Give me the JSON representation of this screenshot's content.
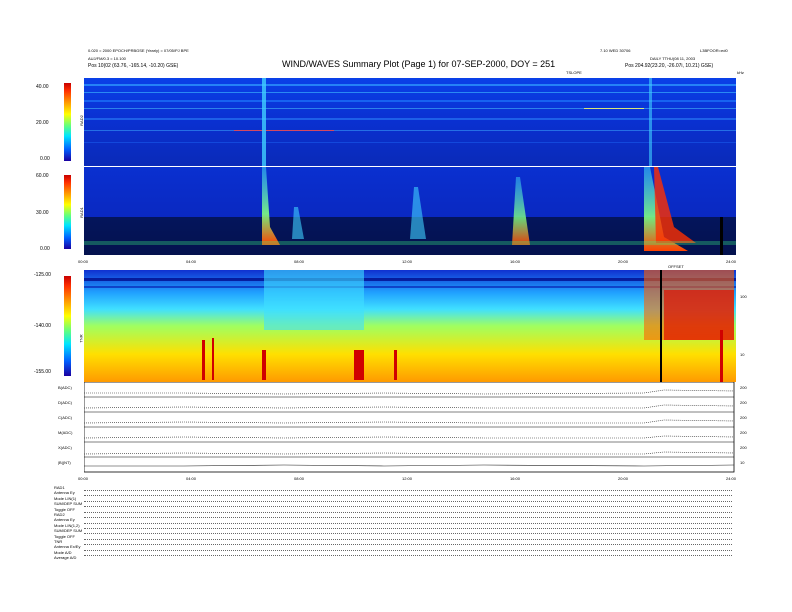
{
  "header": {
    "title": "WIND/WAVES Summary Plot (Page 1) for 07-SEP-2000, DOY = 251",
    "left_line1": "0.020 = 2000 EPOCH/PRBGSE (Yearly) = 07/05/PJ BPE",
    "left_line2": "AUJ/FM/0.3 = 10.100",
    "left_line3": "Pos     10(02 (63.76, -165.14, -10.20) GSE)",
    "right_line1": "7.10 WED 30706",
    "right_line1b": "L3BFOOR=ed0",
    "right_line2": "DAILY TTHU(08 11, 2003",
    "right_line3": "Pos     204.92(23.20, -26.07i, 10.21) GSE)",
    "tag_top": "TSLOPE",
    "tag_rt": "kHz"
  },
  "rad2": {
    "label": "RAD2",
    "ticks": [
      "40.00",
      "20.00",
      "0.00"
    ]
  },
  "rad1": {
    "label": "RAD1",
    "ticks": [
      "60.00",
      "30.00",
      "0.00"
    ]
  },
  "tnr": {
    "label": "TNR",
    "ticks": [
      "-125.00",
      "-140.00",
      "-155.00"
    ],
    "right_ticks": [
      "100",
      "10"
    ],
    "tag": "OFFSET"
  },
  "time_axis": {
    "ticks": [
      "00:00",
      "04:00",
      "08:00",
      "12:00",
      "16:00",
      "20:00",
      "24:00"
    ]
  },
  "line_panels": [
    {
      "label": "B(ADC)",
      "right": "200"
    },
    {
      "label": "D(ADC)",
      "right": "200"
    },
    {
      "label": "C(ADC)",
      "right": "200"
    },
    {
      "label": "M(ADC)",
      "right": "200"
    },
    {
      "label": "X(ADC)",
      "right": "200"
    },
    {
      "label": "|B|(NT)",
      "right": "10"
    }
  ],
  "settings": [
    {
      "label": "RAD1",
      "value": ""
    },
    {
      "label": "Antenna",
      "value": "Ey"
    },
    {
      "label": "Mode",
      "value": "LIN(1)"
    },
    {
      "label": "SUM/DEP",
      "value": "SUM"
    },
    {
      "label": "Toggle",
      "value": "OFF"
    },
    {
      "label": "RAD2",
      "value": ""
    },
    {
      "label": "Antenna",
      "value": "Ey"
    },
    {
      "label": "Mode",
      "value": "LIN(1,2)"
    },
    {
      "label": "SUM/DEP",
      "value": "SUM"
    },
    {
      "label": "Toggle",
      "value": "OFF"
    },
    {
      "label": "TNR",
      "value": ""
    },
    {
      "label": "Antenna",
      "value": "Ex/Ey"
    },
    {
      "label": "Mode",
      "value": "A/D"
    },
    {
      "label": "Average",
      "value": "A/D"
    }
  ],
  "colors": {
    "low": "#1a00a0",
    "mid": "#00e5ff",
    "high": "#c80000",
    "bg": "#0a2ac8"
  }
}
